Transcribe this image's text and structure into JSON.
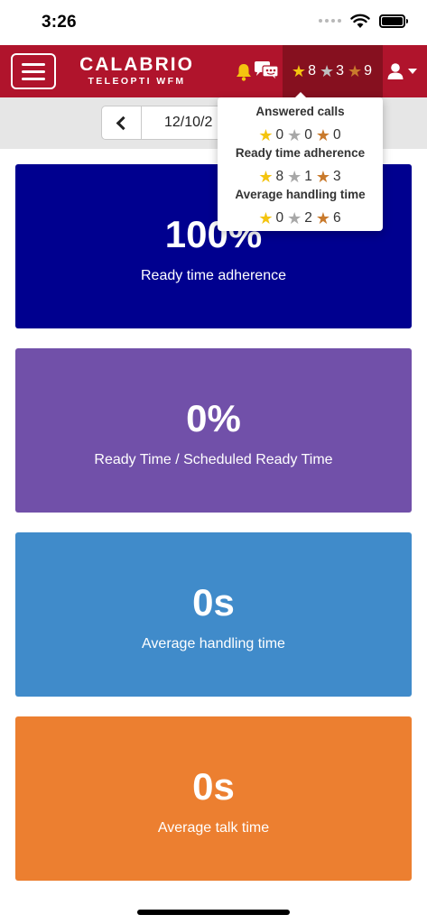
{
  "status_bar": {
    "time": "3:26"
  },
  "header": {
    "brand_name": "CALABRIO",
    "brand_sub": "TELEOPTI WFM",
    "badges": {
      "gold": "8",
      "silver": "3",
      "bronze": "9"
    },
    "colors": {
      "header": "#b0142c",
      "badge_area": "#86101f"
    }
  },
  "date_nav": {
    "date": "12/10/2"
  },
  "popover": {
    "sections": [
      {
        "title": "Answered calls",
        "gold": "0",
        "silver": "0",
        "bronze": "0"
      },
      {
        "title": "Ready time adherence",
        "gold": "8",
        "silver": "1",
        "bronze": "3"
      },
      {
        "title": "Average handling time",
        "gold": "0",
        "silver": "2",
        "bronze": "6"
      }
    ]
  },
  "cards": [
    {
      "value": "100%",
      "label": "Ready time adherence",
      "color": "#00008f"
    },
    {
      "value": "0%",
      "label": "Ready Time / Scheduled Ready Time",
      "color": "#7150a9"
    },
    {
      "value": "0s",
      "label": "Average handling time",
      "color": "#408bca"
    },
    {
      "value": "0s",
      "label": "Average talk time",
      "color": "#ec7f30"
    }
  ],
  "icons": [
    "menu-icon",
    "bell-icon",
    "chat-icon",
    "star-icon",
    "user-icon",
    "caret-down-icon",
    "chevron-left-icon",
    "wifi-icon",
    "battery-icon",
    "signal-icon"
  ]
}
